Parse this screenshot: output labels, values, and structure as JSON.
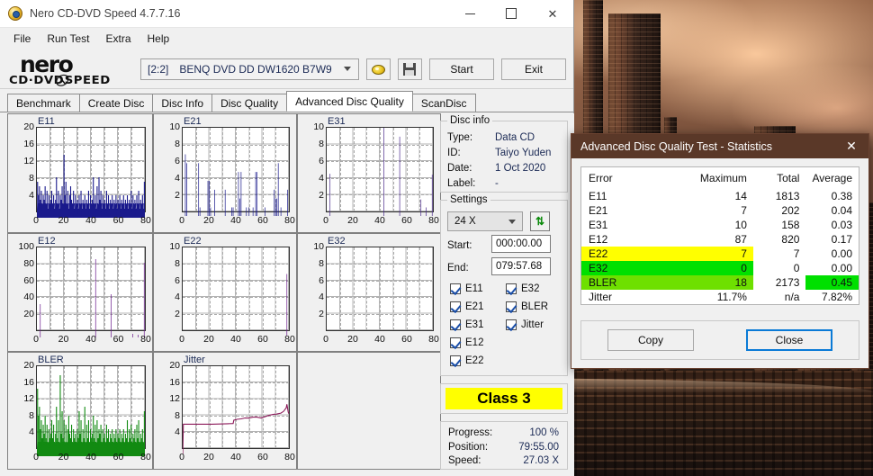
{
  "window": {
    "title": "Nero CD-DVD Speed 4.7.7.16",
    "icon": "nero-disc-icon",
    "minimize": "minimize-icon",
    "maximize": "maximize-icon",
    "close": "✕"
  },
  "menu": {
    "items": [
      "File",
      "Run Test",
      "Extra",
      "Help"
    ]
  },
  "toolbar": {
    "logo_word": "nero",
    "logo_sub_left": "CD·DVD",
    "logo_sub_right": "SPEED",
    "drive": "[2:2] BENQ DVD DD DW1620 B7W9",
    "eject_icon": "eject-disc-icon",
    "save_icon": "save-floppy-icon",
    "start_label": "Start",
    "exit_label": "Exit"
  },
  "tabs": {
    "items": [
      "Benchmark",
      "Create Disc",
      "Disc Info",
      "Disc Quality",
      "Advanced Disc Quality",
      "ScanDisc"
    ],
    "active": "Advanced Disc Quality"
  },
  "disc_info": {
    "legend": "Disc info",
    "rows": [
      {
        "key": "Type:",
        "value": "Data CD"
      },
      {
        "key": "ID:",
        "value": "Taiyo Yuden"
      },
      {
        "key": "Date:",
        "value": "1 Oct 2020"
      },
      {
        "key": "Label:",
        "value": "-"
      }
    ]
  },
  "settings": {
    "legend": "Settings",
    "speed": "24 X",
    "refresh_icon": "refresh-icon",
    "start_label": "Start:",
    "start_value": "000:00.00",
    "end_label": "End:",
    "end_value": "079:57.68",
    "checks_left": [
      "E11",
      "E21",
      "E31",
      "E12",
      "E22"
    ],
    "checks_right": [
      "E32",
      "BLER",
      "Jitter"
    ]
  },
  "class_badge": {
    "label": "Class 3",
    "color": "#ffff00"
  },
  "progress": {
    "rows": [
      {
        "key": "Progress:",
        "value": "100 %"
      },
      {
        "key": "Position:",
        "value": "79:55.00"
      },
      {
        "key": "Speed:",
        "value": "27.03 X"
      }
    ]
  },
  "stats_dialog": {
    "title": "Advanced Disc Quality Test - Statistics",
    "close_icon": "✕",
    "columns": [
      "Error",
      "Maximum",
      "Total",
      "Average"
    ],
    "rows": [
      {
        "error": "E11",
        "maximum": "14",
        "total": "1813",
        "average": "0.38",
        "style": ""
      },
      {
        "error": "E21",
        "maximum": "7",
        "total": "202",
        "average": "0.04",
        "style": ""
      },
      {
        "error": "E31",
        "maximum": "10",
        "total": "158",
        "average": "0.03",
        "style": ""
      },
      {
        "error": "E12",
        "maximum": "87",
        "total": "820",
        "average": "0.17",
        "style": ""
      },
      {
        "error": "E22",
        "maximum": "7",
        "total": "7",
        "average": "0.00",
        "style": "row-yellow"
      },
      {
        "error": "E32",
        "maximum": "0",
        "total": "0",
        "average": "0.00",
        "style": "row-green"
      },
      {
        "error": "BLER",
        "maximum": "18",
        "total": "2173",
        "average": "0.45",
        "style": "row-bler"
      },
      {
        "error": "Jitter",
        "maximum": "11.7%",
        "total": "n/a",
        "average": "7.82%",
        "style": ""
      }
    ],
    "copy_label": "Copy",
    "close_label": "Close"
  },
  "chart_data": [
    {
      "type": "bar",
      "title": "E11",
      "color": "#1a1a8c",
      "xlabel": "",
      "ylabel": "",
      "xlim": [
        0,
        80
      ],
      "ylim": [
        0,
        20
      ],
      "xticks": [
        0,
        20,
        40,
        60,
        80
      ],
      "yticks": [
        4,
        8,
        12,
        16,
        20
      ],
      "grid": true,
      "x": [
        0.5,
        1.2,
        1.9,
        2.6,
        3.3,
        4.0,
        4.7,
        5.4,
        6.1,
        6.8,
        7.5,
        8.2,
        8.9,
        9.6,
        10.3,
        11.0,
        11.7,
        12.4,
        13.1,
        13.8,
        14.5,
        15.2,
        15.9,
        16.6,
        17.3,
        18.0,
        18.7,
        19.4,
        20.1,
        20.8,
        21.5,
        22.2,
        22.9,
        23.6,
        24.3,
        25.0,
        25.7,
        26.4,
        27.1,
        27.8,
        28.5,
        29.2,
        29.9,
        30.6,
        31.3,
        32.0,
        32.7,
        33.4,
        34.1,
        34.8,
        35.5,
        36.2,
        36.9,
        37.6,
        38.3,
        39.0,
        39.7,
        40.4,
        41.1,
        41.8,
        42.5,
        43.2,
        43.9,
        44.6,
        45.3,
        46.0,
        46.7,
        47.4,
        48.1,
        48.8,
        49.5,
        50.2,
        50.9,
        51.6,
        52.3,
        53.0,
        53.7,
        54.4,
        55.1,
        55.8,
        56.5,
        57.2,
        57.9,
        58.6,
        59.3,
        60.0,
        60.7,
        61.4,
        62.1,
        62.8,
        63.5,
        64.2,
        64.9,
        65.6,
        66.3,
        67.0,
        67.7,
        68.4,
        69.1,
        69.8,
        70.5,
        71.2,
        71.9,
        72.6,
        73.3,
        74.0,
        74.7,
        75.4,
        76.1,
        76.8,
        77.5,
        78.2,
        78.9,
        79.6
      ],
      "values": [
        8,
        5,
        7,
        4,
        6,
        3,
        5,
        4,
        7,
        3,
        6,
        2,
        5,
        3,
        4,
        6,
        3,
        5,
        2,
        4,
        9,
        3,
        6,
        2,
        5,
        4,
        7,
        3,
        14,
        5,
        8,
        3,
        6,
        2,
        5,
        7,
        4,
        3,
        6,
        2,
        5,
        3,
        4,
        2,
        5,
        3,
        6,
        2,
        4,
        3,
        5,
        2,
        4,
        3,
        6,
        2,
        5,
        3,
        4,
        9,
        3,
        5,
        2,
        7,
        3,
        9,
        4,
        6,
        2,
        5,
        3,
        4,
        2,
        6,
        3,
        5,
        2,
        4,
        3,
        5,
        2,
        4,
        3,
        5,
        2,
        4,
        3,
        5,
        2,
        4,
        3,
        5,
        2,
        4,
        3,
        5,
        2,
        4,
        3,
        6,
        2,
        5,
        3,
        4,
        2,
        5,
        3,
        6,
        2,
        4,
        3,
        5,
        2,
        8
      ]
    },
    {
      "type": "bar",
      "title": "E21",
      "color": "#1a1a8c",
      "xlim": [
        0,
        80
      ],
      "ylim": [
        0,
        10
      ],
      "xticks": [
        0,
        20,
        40,
        60,
        80
      ],
      "yticks": [
        2,
        4,
        6,
        8,
        10
      ],
      "grid": true,
      "x": [
        2,
        3,
        12,
        13,
        19,
        20,
        21,
        24,
        32,
        37,
        38,
        42,
        43,
        44,
        48,
        50,
        53,
        55,
        56,
        62,
        69,
        70,
        71,
        72,
        74,
        79
      ],
      "values": [
        7,
        6,
        6,
        1,
        4,
        4,
        1,
        3,
        3,
        1,
        1,
        5,
        2,
        5,
        1,
        1,
        1,
        5,
        5,
        1,
        3,
        2,
        2,
        6,
        1,
        3
      ]
    },
    {
      "type": "bar",
      "title": "E31",
      "color": "#4b2a8c",
      "xlim": [
        0,
        80
      ],
      "ylim": [
        0,
        10
      ],
      "xticks": [
        0,
        20,
        40,
        60,
        80
      ],
      "yticks": [
        2,
        4,
        6,
        8,
        10
      ],
      "grid": true,
      "x": [
        2.5,
        43,
        55,
        71,
        75,
        79.5
      ],
      "values": [
        4.8,
        10,
        9,
        1.9,
        1.0,
        4.7
      ]
    },
    {
      "type": "bar",
      "title": "E12",
      "color": "#6b1a8c",
      "xlim": [
        0,
        80
      ],
      "ylim": [
        0,
        100
      ],
      "xticks": [
        0,
        20,
        40,
        60,
        80
      ],
      "yticks": [
        20,
        40,
        60,
        80,
        100
      ],
      "grid": true,
      "x": [
        2.5,
        43.5,
        55,
        71,
        75,
        79.5
      ],
      "values": [
        37,
        87,
        48,
        4,
        3,
        83
      ]
    },
    {
      "type": "bar",
      "title": "E22",
      "color": "#6b1a8c",
      "xlim": [
        0,
        80
      ],
      "ylim": [
        0,
        10
      ],
      "xticks": [
        0,
        20,
        40,
        60,
        80
      ],
      "yticks": [
        2,
        4,
        6,
        8,
        10
      ],
      "grid": true,
      "x": [
        78.5
      ],
      "values": [
        7
      ]
    },
    {
      "type": "bar",
      "title": "E32",
      "color": "#6b1a8c",
      "xlim": [
        0,
        80
      ],
      "ylim": [
        0,
        10
      ],
      "xticks": [
        0,
        20,
        40,
        60,
        80
      ],
      "yticks": [
        2,
        4,
        6,
        8,
        10
      ],
      "grid": true,
      "x": [],
      "values": []
    },
    {
      "type": "bar",
      "title": "BLER",
      "color": "#128a12",
      "xlim": [
        0,
        80
      ],
      "ylim": [
        0,
        20
      ],
      "xticks": [
        0,
        20,
        40,
        60,
        80
      ],
      "yticks": [
        4,
        8,
        12,
        16,
        20
      ],
      "grid": true,
      "x": [
        0.5,
        1.2,
        1.9,
        2.6,
        3.3,
        4.0,
        4.7,
        5.4,
        6.1,
        6.8,
        7.5,
        8.2,
        8.9,
        9.6,
        10.3,
        11.0,
        11.7,
        12.4,
        13.1,
        13.8,
        14.5,
        15.2,
        15.9,
        16.6,
        17.3,
        18.0,
        18.7,
        19.4,
        20.1,
        20.8,
        21.5,
        22.2,
        22.9,
        23.6,
        24.3,
        25.0,
        25.7,
        26.4,
        27.1,
        27.8,
        28.5,
        29.2,
        29.9,
        30.6,
        31.3,
        32.0,
        32.7,
        33.4,
        34.1,
        34.8,
        35.5,
        36.2,
        36.9,
        37.6,
        38.3,
        39.0,
        39.7,
        40.4,
        41.1,
        41.8,
        42.5,
        43.2,
        43.9,
        44.6,
        45.3,
        46.0,
        46.7,
        47.4,
        48.1,
        48.8,
        49.5,
        50.2,
        50.9,
        51.6,
        52.3,
        53.0,
        53.7,
        54.4,
        55.1,
        55.8,
        56.5,
        57.2,
        57.9,
        58.6,
        59.3,
        60.0,
        60.7,
        61.4,
        62.1,
        62.8,
        63.5,
        64.2,
        64.9,
        65.6,
        66.3,
        67.0,
        67.7,
        68.4,
        69.1,
        69.8,
        70.5,
        71.2,
        71.9,
        72.6,
        73.3,
        74.0,
        74.7,
        75.4,
        76.1,
        76.8,
        77.5,
        78.2,
        78.9,
        79.6
      ],
      "values": [
        15,
        9,
        11,
        6,
        8,
        4,
        7,
        5,
        9,
        4,
        7,
        3,
        6,
        4,
        5,
        8,
        4,
        7,
        3,
        5,
        11,
        4,
        8,
        3,
        18,
        5,
        10,
        4,
        8,
        3,
        7,
        3,
        6,
        9,
        5,
        4,
        7,
        3,
        6,
        4,
        5,
        3,
        6,
        4,
        10,
        5,
        8,
        3,
        6,
        4,
        11,
        3,
        7,
        4,
        8,
        3,
        6,
        4,
        5,
        9,
        4,
        7,
        3,
        8,
        4,
        6,
        5,
        7,
        3,
        6,
        4,
        5,
        3,
        7,
        4,
        6,
        3,
        5,
        4,
        6,
        3,
        5,
        4,
        6,
        3,
        5,
        4,
        6,
        3,
        5,
        4,
        6,
        3,
        5,
        4,
        8,
        3,
        6,
        4,
        7,
        3,
        5,
        4,
        6,
        3,
        7,
        4,
        8,
        3,
        5,
        4,
        6,
        3,
        10
      ]
    },
    {
      "type": "line",
      "title": "Jitter",
      "color": "#8c1a5a",
      "xlim": [
        0,
        80
      ],
      "ylim": [
        0,
        20
      ],
      "xticks": [
        0,
        20,
        40,
        60,
        80
      ],
      "yticks": [
        4,
        8,
        12,
        16,
        20
      ],
      "grid": true,
      "x": [
        0,
        0.5,
        4,
        10,
        16,
        22,
        28,
        34,
        38,
        38.5,
        41,
        44,
        47,
        50,
        53,
        56,
        59,
        62,
        65,
        68,
        71,
        74,
        76,
        77,
        78,
        78.5,
        79,
        79.5,
        80
      ],
      "values": [
        0,
        6.9,
        6.9,
        6.9,
        6.9,
        6.9,
        6.95,
        7.0,
        7.05,
        7.8,
        8.0,
        8.1,
        8.3,
        8.3,
        8.5,
        8.5,
        8.3,
        8.6,
        8.9,
        9.1,
        9.2,
        9.4,
        9.8,
        10.2,
        10.6,
        11.4,
        10.5,
        9.6,
        9.3
      ]
    }
  ]
}
